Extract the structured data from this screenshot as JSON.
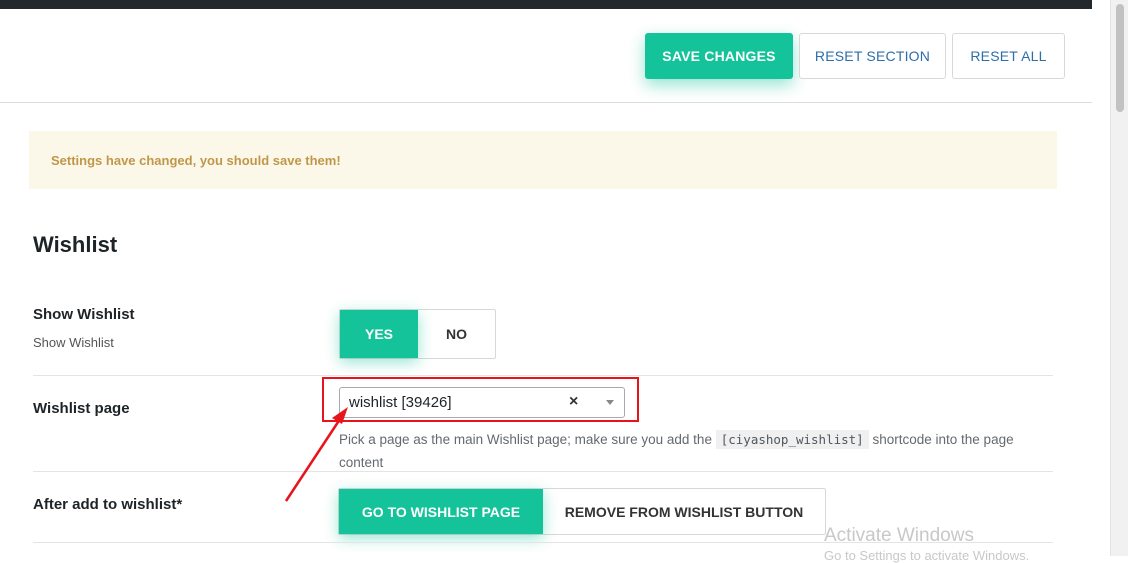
{
  "toolbar": {
    "save_label": "SAVE CHANGES",
    "reset_section_label": "RESET SECTION",
    "reset_all_label": "RESET ALL"
  },
  "notice": {
    "text": "Settings have changed, you should save them!"
  },
  "section": {
    "title": "Wishlist"
  },
  "fields": {
    "show_wishlist": {
      "label": "Show Wishlist",
      "description": "Show Wishlist",
      "options": [
        "YES",
        "NO"
      ],
      "selected": "YES"
    },
    "wishlist_page": {
      "label": "Wishlist page",
      "value": "wishlist [39426]",
      "clear_glyph": "×",
      "help_before": "Pick a page as the main Wishlist page; make sure you add the",
      "help_code": "[ciyashop_wishlist]",
      "help_after": "shortcode into the page content"
    },
    "after_add": {
      "label": "After add to wishlist*",
      "options": [
        "GO TO WISHLIST PAGE",
        "REMOVE FROM WISHLIST BUTTON"
      ],
      "selected": "GO TO WISHLIST PAGE"
    }
  },
  "watermark": {
    "line1": "Activate Windows",
    "line2": "Go to Settings to activate Windows."
  },
  "colors": {
    "accent": "#15c39a",
    "link": "#2d6ea8",
    "notice_bg": "#fcf8e9",
    "notice_text": "#c0974a",
    "annotation": "#e8141b"
  }
}
